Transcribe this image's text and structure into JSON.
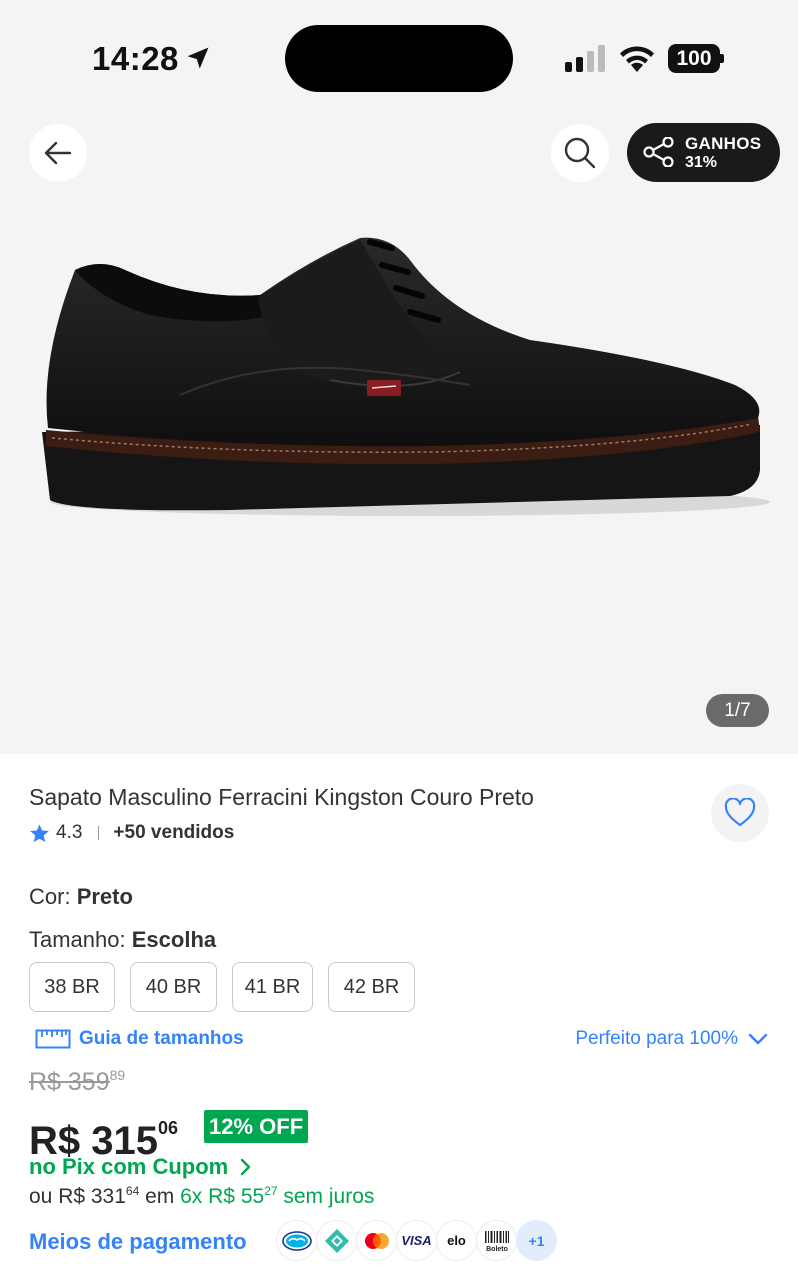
{
  "status_bar": {
    "time": "14:28",
    "battery": "100"
  },
  "header": {
    "share_title": "GANHOS",
    "share_percent": "31%"
  },
  "gallery": {
    "pager": "1/7"
  },
  "product": {
    "title": "Sapato Masculino Ferracini Kingston Couro Preto",
    "rating": "4.3",
    "sold": "+50 vendidos",
    "color_label": "Cor:",
    "color_value": "Preto",
    "size_label": "Tamanho:",
    "size_value": "Escolha",
    "sizes": [
      "38 BR",
      "40 BR",
      "41 BR",
      "42 BR"
    ],
    "size_guide": "Guia de tamanhos",
    "fit": "Perfeito para 100%"
  },
  "pricing": {
    "old_price_main": "R$ 359",
    "old_price_cents": "89",
    "price_main": "R$ 315",
    "price_cents": "06",
    "discount": "12% OFF",
    "pix_text": "no Pix com Cupom",
    "installment_prefix": "ou R$ 331",
    "installment_total_cents": "64",
    "installment_mid": " em ",
    "installment_plan": "6x R$ 55",
    "installment_plan_cents": "27",
    "installment_suffix": " sem juros"
  },
  "payments": {
    "link": "Meios de pagamento",
    "methods": [
      "mercado-pago",
      "pix",
      "mastercard",
      "VISA",
      "elo",
      "Boleto"
    ],
    "more": "+1"
  },
  "colors": {
    "accent_blue": "#3483fa",
    "green": "#00a650",
    "hero_bg": "#f4f4f4"
  }
}
